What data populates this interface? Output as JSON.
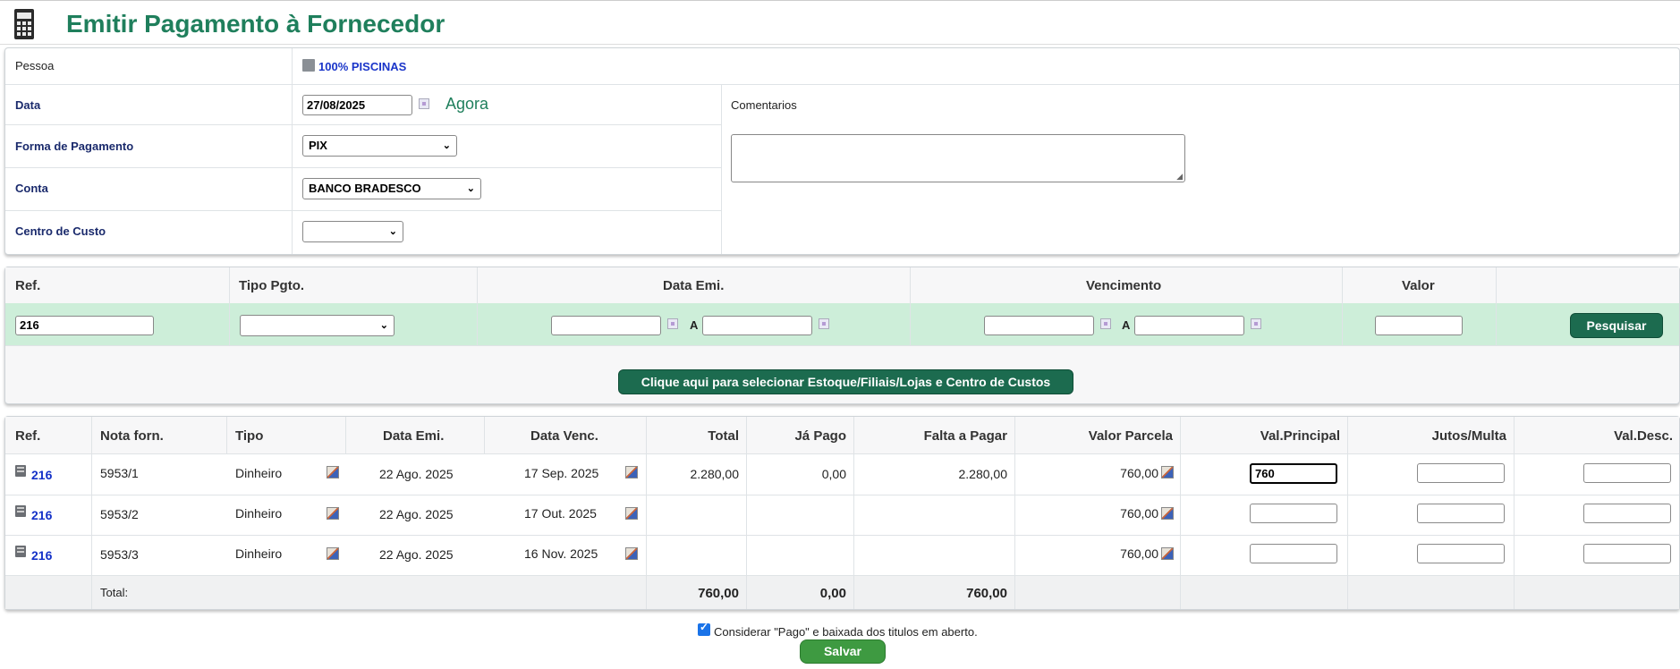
{
  "page": {
    "title": "Emitir Pagamento à Fornecedor"
  },
  "form": {
    "pessoa_label": "Pessoa",
    "pessoa_value": "100% PISCINAS",
    "data_label": "Data",
    "data_value": "27/08/2025",
    "agora_label": "Agora",
    "forma_label": "Forma de Pagamento",
    "forma_value": "PIX",
    "conta_label": "Conta",
    "conta_value": "BANCO BRADESCO",
    "centro_label": "Centro de Custo",
    "centro_value": "",
    "comentarios_label": "Comentarios",
    "comentarios_value": ""
  },
  "search": {
    "ref_label": "Ref.",
    "tipo_label": "Tipo Pgto.",
    "data_emi_label": "Data Emi.",
    "venc_label": "Vencimento",
    "valor_label": "Valor",
    "ref_value": "216",
    "range_sep": "A",
    "pesquisar_label": "Pesquisar",
    "select_estoque_label": "Clique aqui para selecionar Estoque/Filiais/Lojas e Centro de Custos"
  },
  "table": {
    "headers": {
      "ref": "Ref.",
      "nota": "Nota forn.",
      "tipo": "Tipo",
      "data_emi": "Data Emi.",
      "data_venc": "Data Venc.",
      "total": "Total",
      "ja_pago": "Já Pago",
      "falta": "Falta a Pagar",
      "valor_parcela": "Valor Parcela",
      "val_principal": "Val.Principal",
      "juros": "Jutos/Multa",
      "val_desc": "Val.Desc."
    },
    "rows": [
      {
        "ref": "216",
        "nota": "5953/1",
        "tipo": "Dinheiro",
        "data_emi": "22 Ago. 2025",
        "data_venc": "17 Sep. 2025",
        "total": "2.280,00",
        "ja_pago": "0,00",
        "falta": "2.280,00",
        "valor_parcela": "760,00",
        "val_principal": "760"
      },
      {
        "ref": "216",
        "nota": "5953/2",
        "tipo": "Dinheiro",
        "data_emi": "22 Ago. 2025",
        "data_venc": "17 Out. 2025",
        "total": "",
        "ja_pago": "",
        "falta": "",
        "valor_parcela": "760,00",
        "val_principal": ""
      },
      {
        "ref": "216",
        "nota": "5953/3",
        "tipo": "Dinheiro",
        "data_emi": "22 Ago. 2025",
        "data_venc": "16 Nov. 2025",
        "total": "",
        "ja_pago": "",
        "falta": "",
        "valor_parcela": "760,00",
        "val_principal": ""
      }
    ],
    "footer": {
      "label": "Total:",
      "total": "760,00",
      "ja_pago": "0,00",
      "falta": "760,00"
    }
  },
  "bottom": {
    "checkbox_label": "Considerar \"Pago\" e baixada dos titulos em aberto.",
    "salvar_label": "Salvar"
  },
  "colors": {
    "title_green": "#1f7f5c",
    "button_green": "#1c6b4f",
    "save_green": "#3e9a41",
    "search_row_bg": "#cdeed9",
    "link_blue": "#1431c8"
  }
}
